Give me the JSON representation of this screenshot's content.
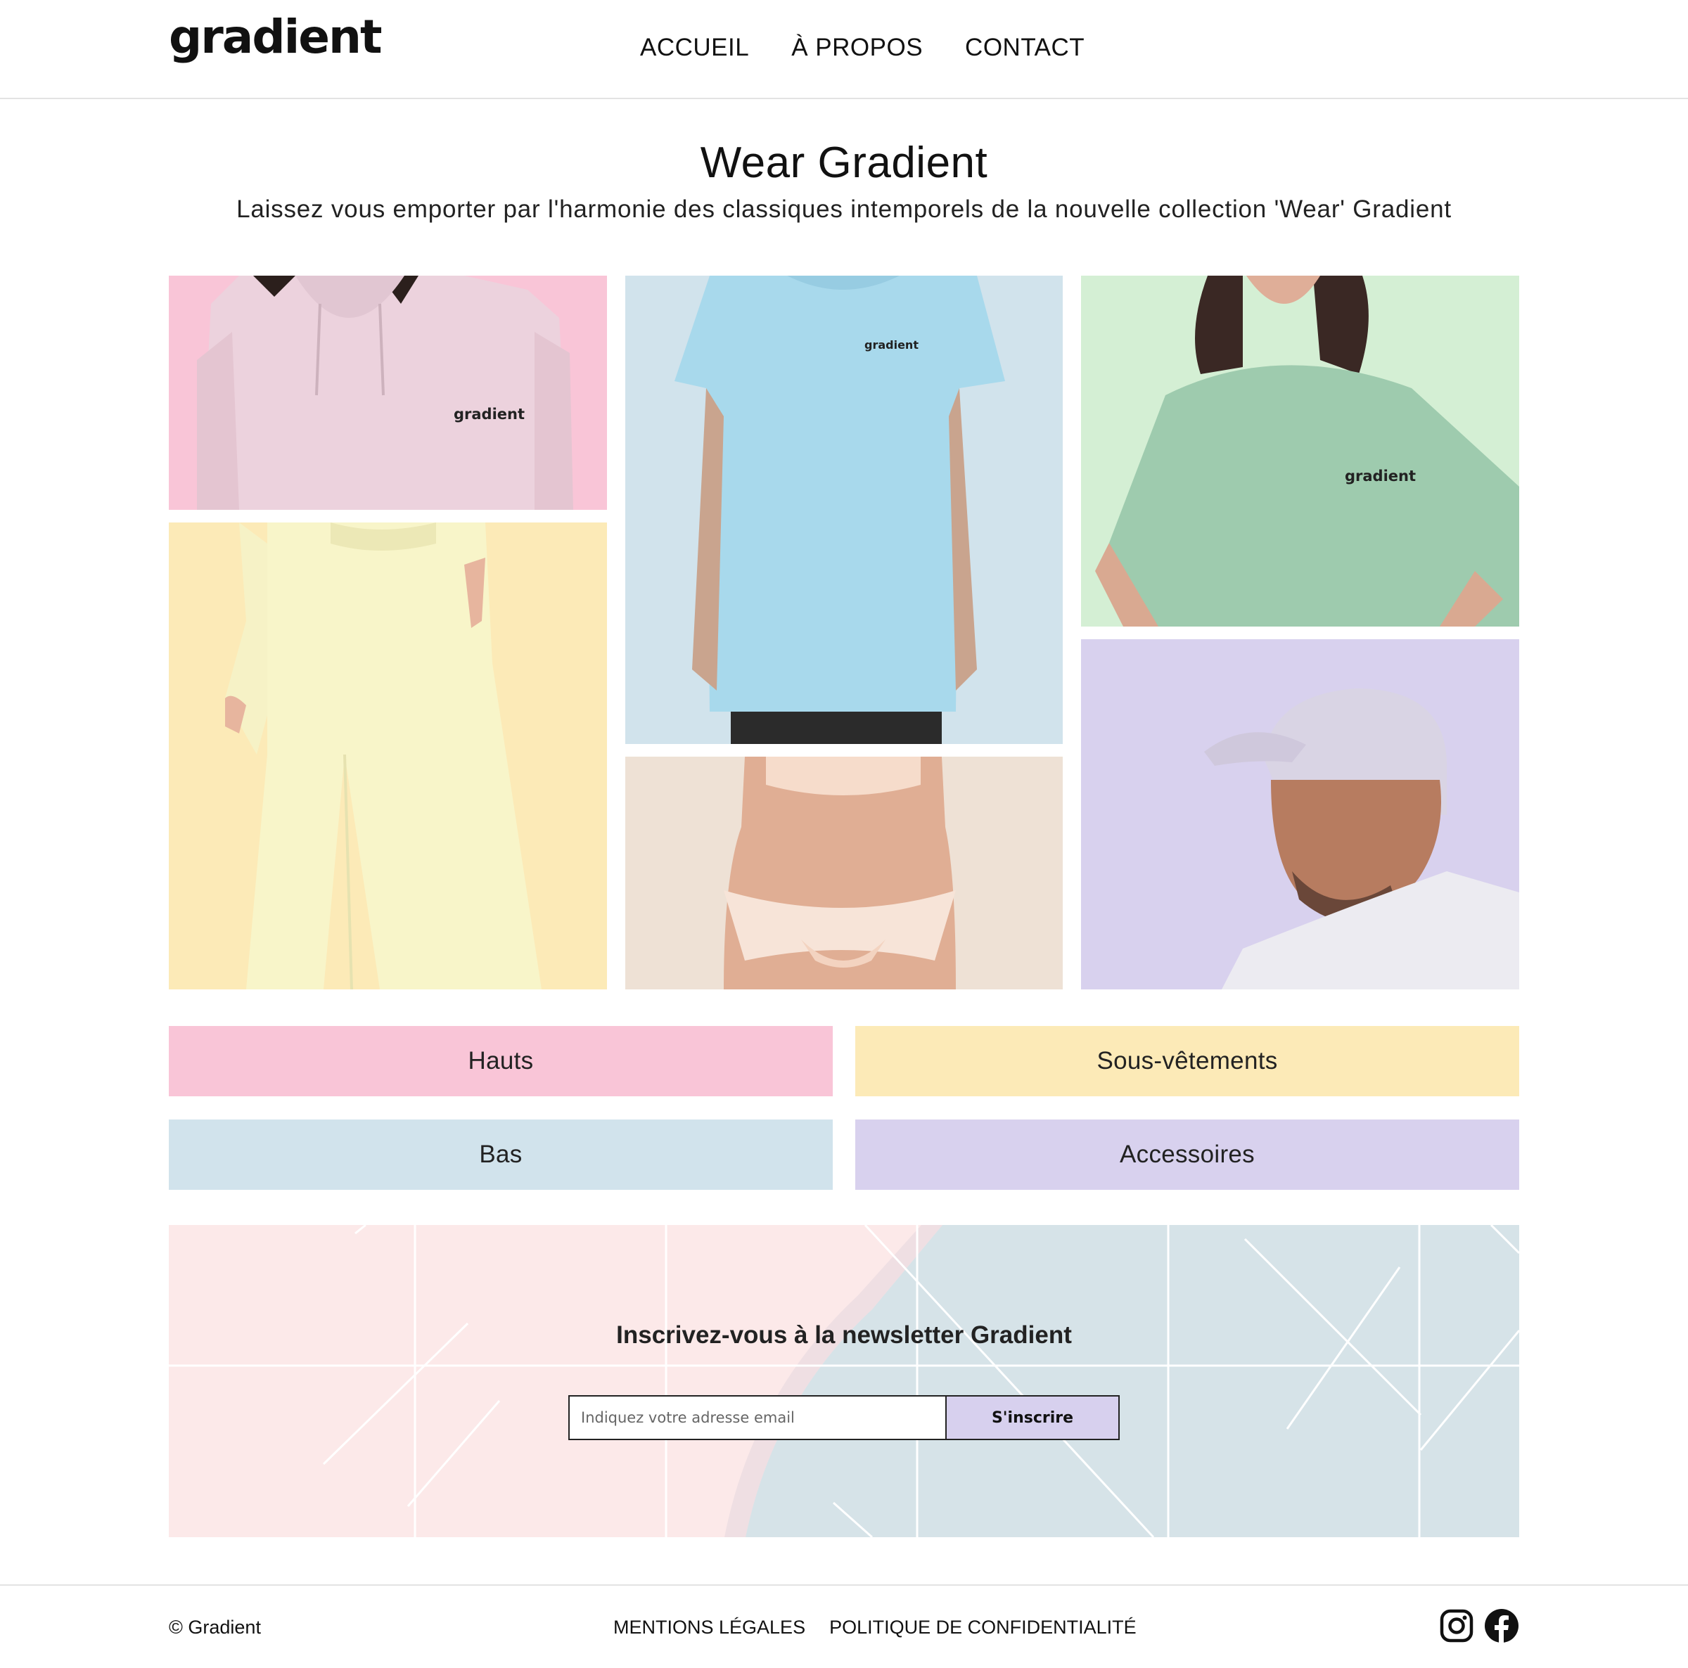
{
  "header": {
    "logo": "gradient",
    "nav": [
      "ACCUEIL",
      "À PROPOS",
      "CONTACT"
    ]
  },
  "hero": {
    "title": "Wear Gradient",
    "subtitle": "Laissez vous emporter par l'harmonie des classiques intemporels de la nouvelle collection 'Wear' Gradient"
  },
  "gallery": {
    "items": [
      {
        "name": "hoodie",
        "bg": "#f9c5d7",
        "print": "gradient"
      },
      {
        "name": "tshirt-blue",
        "bg": "#d1e3ec",
        "print": "gradient"
      },
      {
        "name": "tshirt-green",
        "bg": "#d4efd4",
        "print": "gradient"
      },
      {
        "name": "joggers",
        "bg": "#fceab7"
      },
      {
        "name": "lingerie",
        "bg": "#eee1d5"
      },
      {
        "name": "cap",
        "bg": "#d8d1ee"
      }
    ]
  },
  "categories": [
    {
      "label": "Hauts",
      "color": "#f9c5d7"
    },
    {
      "label": "Sous-vêtements",
      "color": "#fceab7"
    },
    {
      "label": "Bas",
      "color": "#d1e3ec"
    },
    {
      "label": "Accessoires",
      "color": "#d8d1ee"
    }
  ],
  "newsletter": {
    "title": "Inscrivez-vous à la newsletter Gradient",
    "placeholder": "Indiquez votre adresse email",
    "button": "S'inscrire"
  },
  "footer": {
    "copyright": "© Gradient",
    "links": [
      "MENTIONS LÉGALES",
      "POLITIQUE DE CONFIDENTIALITÉ"
    ],
    "social": [
      "instagram-icon",
      "facebook-icon"
    ]
  }
}
